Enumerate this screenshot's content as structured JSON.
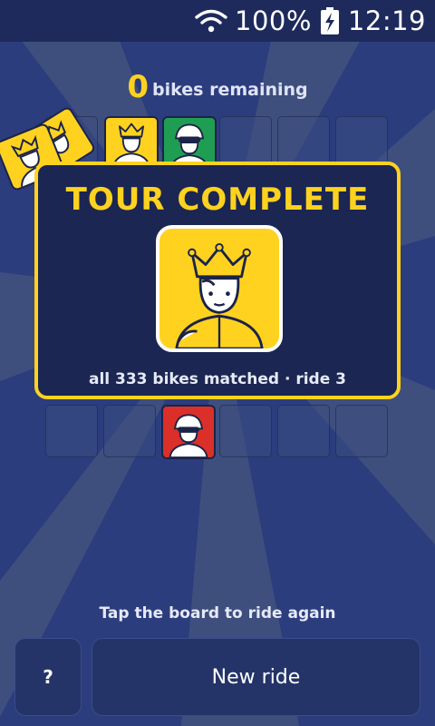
{
  "status_bar": {
    "battery": "100%",
    "time": "12:19",
    "icons": [
      "wifi-icon",
      "battery-charging-icon"
    ]
  },
  "counter": {
    "count": "0",
    "label": "bikes remaining"
  },
  "board": {
    "columns": 6,
    "tiles": [
      {
        "color": "yellow",
        "rider": "king-rider"
      },
      {
        "color": "green",
        "rider": "helmet-rider"
      },
      {
        "color": "red",
        "rider": "helmet-rider"
      }
    ]
  },
  "modal": {
    "title": "TOUR COMPLETE",
    "subtitle": "all 333 bikes matched · ride 3",
    "card": "king-rider"
  },
  "hint": "Tap the board to ride again",
  "controls": {
    "help_label": "?",
    "new_ride_label": "New ride"
  },
  "colors": {
    "background": "#2c3d7e",
    "accent": "#ffd21f",
    "tile_yellow": "#ffd21f",
    "tile_green": "#1f9e53",
    "tile_red": "#db2f2a"
  }
}
